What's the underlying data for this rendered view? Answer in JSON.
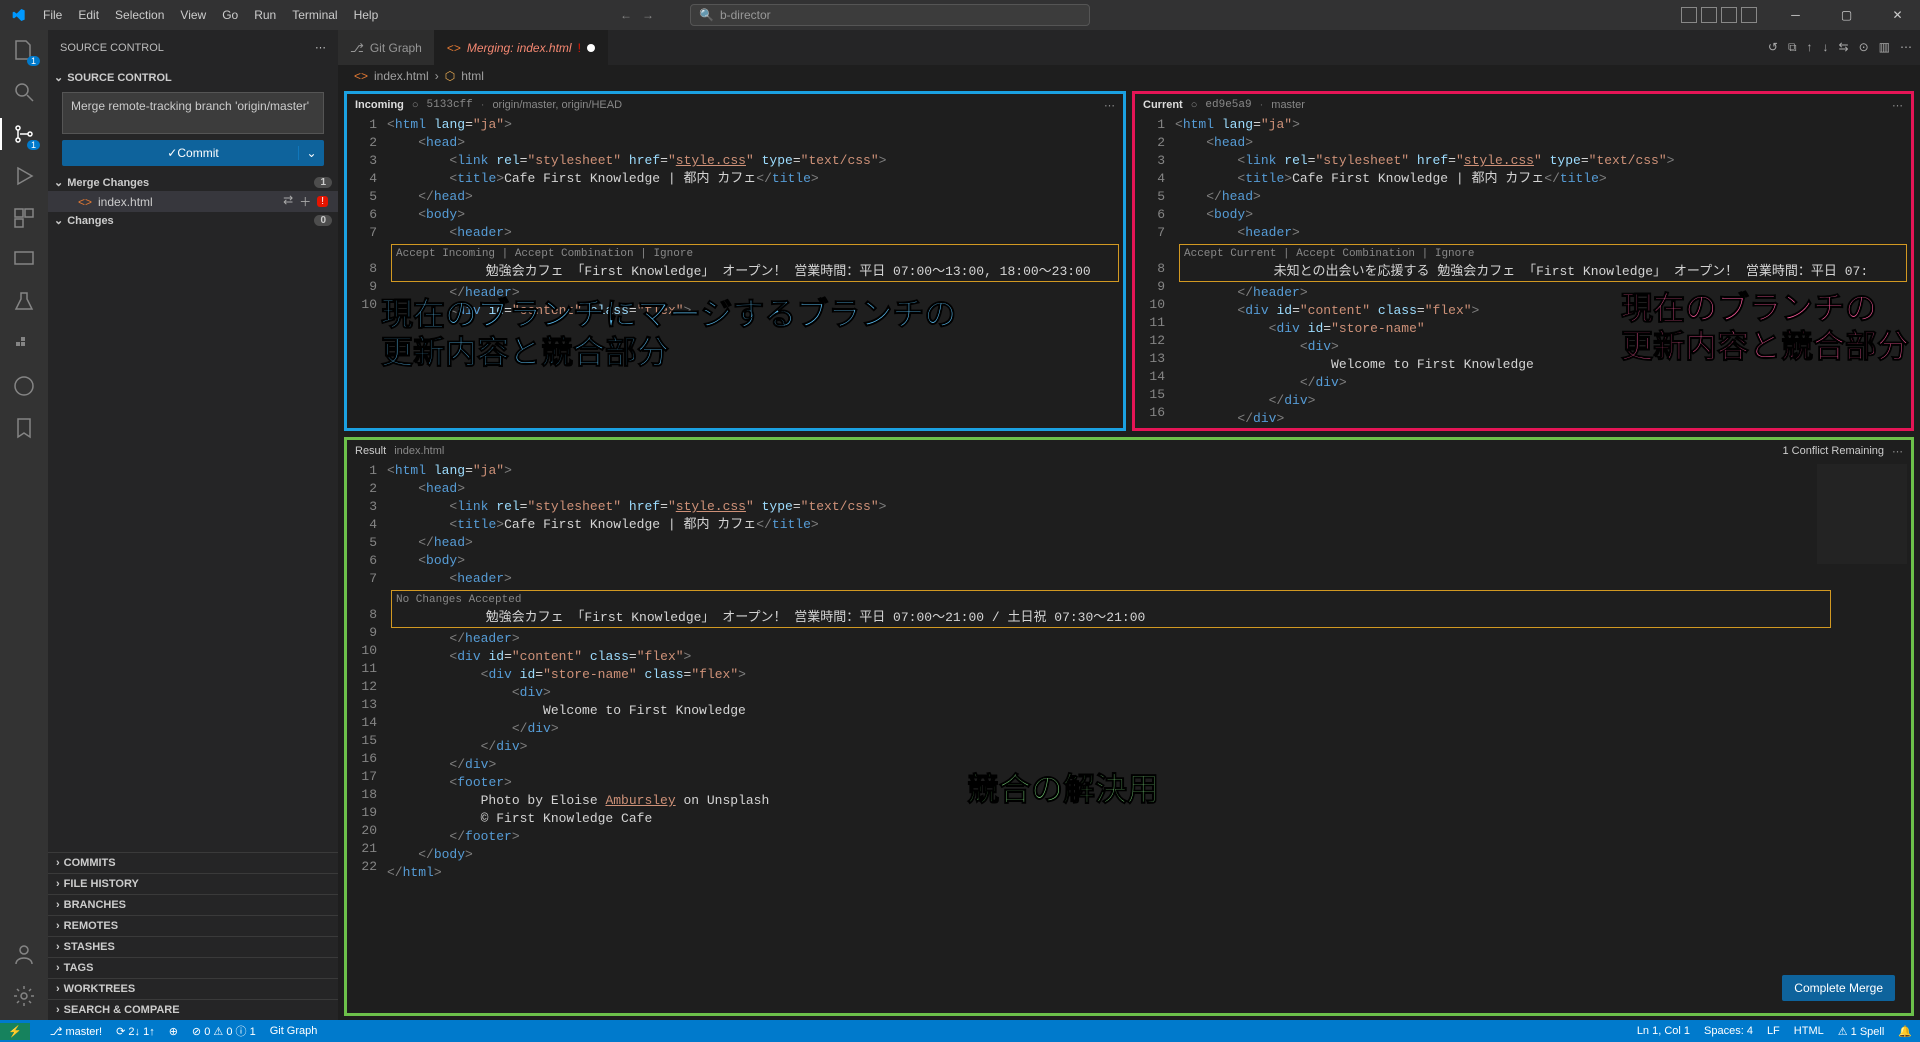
{
  "menu": [
    "File",
    "Edit",
    "Selection",
    "View",
    "Go",
    "Run",
    "Terminal",
    "Help"
  ],
  "search_placeholder": "b-director",
  "sidebar": {
    "title": "SOURCE CONTROL",
    "section": "SOURCE CONTROL",
    "commit_msg": "Merge remote-tracking branch 'origin/master'",
    "commit_btn": "Commit",
    "merge_changes": "Merge Changes",
    "merge_count": "1",
    "file": "index.html",
    "file_badge": "!",
    "changes": "Changes",
    "changes_count": "0",
    "accordion": [
      "COMMITS",
      "FILE HISTORY",
      "BRANCHES",
      "REMOTES",
      "STASHES",
      "TAGS",
      "WORKTREES",
      "SEARCH & COMPARE"
    ]
  },
  "tabs": {
    "gitgraph": "Git Graph",
    "merging": "Merging: index.html"
  },
  "breadcrumb": {
    "file": "index.html",
    "el": "html"
  },
  "incoming": {
    "title": "Incoming",
    "commit": "5133cff",
    "branch": "origin/master, origin/HEAD",
    "codelens": "Accept Incoming | Accept Combination | Ignore",
    "line8": "            勉強会カフェ 「First Knowledge」 オープン！ 営業時間：平日 07:00～13:00, 18:00～23:00",
    "annot": "現在のブランチにマージするブランチの\n更新内容と競合部分"
  },
  "current": {
    "title": "Current",
    "commit": "ed9e5a9",
    "branch": "master",
    "codelens": "Accept Current | Accept Combination | Ignore",
    "line8": "            未知との出会いを応援する 勉強会カフェ 「First Knowledge」 オープン！ 営業時間：平日 07:",
    "line13": "                    Welcome to First Knowledge",
    "annot": "現在のブランチの\n更新内容と競合部分"
  },
  "shared": {
    "l1": "<html lang=\"ja\">",
    "l2": "    <head>",
    "l3a": "        <link rel=\"stylesheet\" href=\"",
    "l3link": "style.css",
    "l3b": "\" type=\"text/css\">",
    "l4a": "        <title>",
    "l4t": "Cafe First Knowledge | 都内 カフェ",
    "l4b": "</title>",
    "l5": "    </head>",
    "l6": "    <body>",
    "l7": "        <header>",
    "l9": "        </header>",
    "l10": "        <div id=\"content\" class=\"flex\">",
    "l11": "            <div id=\"store-name\" class=\"flex\">",
    "l12": "                <div>",
    "l14": "                </div>",
    "l15": "            </div>",
    "l16": "        </div>"
  },
  "result": {
    "title": "Result",
    "file": "index.html",
    "codelens": "No Changes Accepted",
    "conflicts": "1 Conflict Remaining",
    "line8": "            勉強会カフェ 「First Knowledge」 オープン！ 営業時間：平日 07:00～21:00 / 土日祝 07:30～21:00",
    "line13": "                    Welcome to First Knowledge",
    "l17": "        <footer>",
    "l18a": "            Photo by Eloise ",
    "l18u": "Ambursley",
    "l18b": " on Unsplash",
    "l19": "            © First Knowledge Cafe",
    "l20": "        </footer>",
    "l21": "    </body>",
    "l22": "</html>",
    "annot": "競合の解決用",
    "complete": "Complete Merge"
  },
  "status": {
    "branch": "master!",
    "sync": "2↓ 1↑",
    "errors": "0",
    "warnings": "0",
    "info": "1",
    "gitgraph": "Git Graph",
    "lncol": "Ln 1, Col 1",
    "spaces": "Spaces: 4",
    "eol": "LF",
    "lang": "HTML",
    "spell": "1 Spell"
  }
}
